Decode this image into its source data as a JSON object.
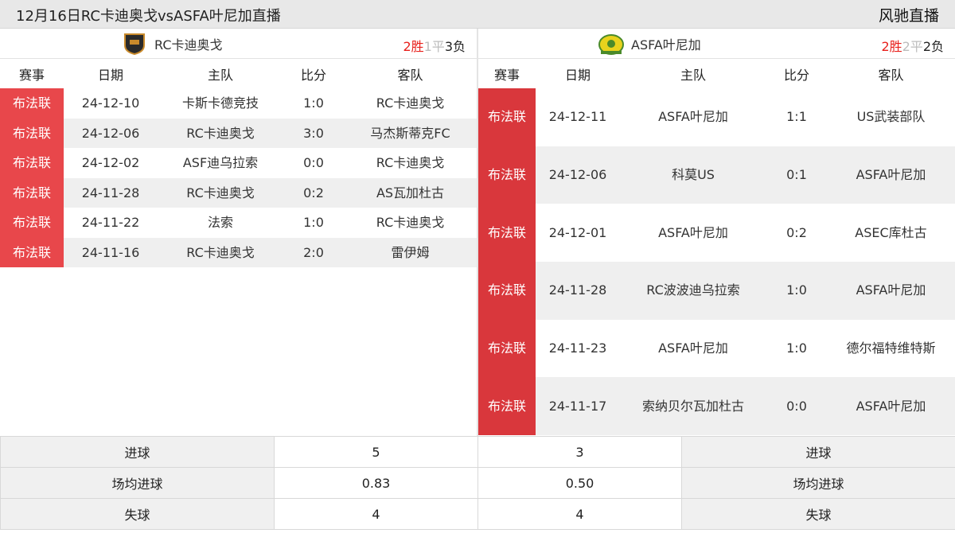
{
  "header": {
    "title": "12月16日RC卡迪奥戈vsASFA叶尼加直播",
    "brand": "风驰直播"
  },
  "columns": {
    "league": "赛事",
    "date": "日期",
    "home": "主队",
    "score": "比分",
    "away": "客队"
  },
  "left_team": {
    "name": "RC卡迪奥戈",
    "logo_icon": "team-crest-icon",
    "record": {
      "wins": "2胜",
      "draws": "1平",
      "losses": "3负"
    },
    "games": [
      {
        "league": "布法联",
        "date": "24-12-10",
        "home": "卡斯卡德竞技",
        "score": "1:0",
        "away": "RC卡迪奥戈"
      },
      {
        "league": "布法联",
        "date": "24-12-06",
        "home": "RC卡迪奥戈",
        "score": "3:0",
        "away": "马杰斯蒂克FC"
      },
      {
        "league": "布法联",
        "date": "24-12-02",
        "home": "ASF迪乌拉索",
        "score": "0:0",
        "away": "RC卡迪奥戈"
      },
      {
        "league": "布法联",
        "date": "24-11-28",
        "home": "RC卡迪奥戈",
        "score": "0:2",
        "away": "AS瓦加杜古"
      },
      {
        "league": "布法联",
        "date": "24-11-22",
        "home": "法索",
        "score": "1:0",
        "away": "RC卡迪奥戈"
      },
      {
        "league": "布法联",
        "date": "24-11-16",
        "home": "RC卡迪奥戈",
        "score": "2:0",
        "away": "雷伊姆"
      }
    ]
  },
  "right_team": {
    "name": "ASFA叶尼加",
    "logo_icon": "team-crest-icon",
    "record": {
      "wins": "2胜",
      "draws": "2平",
      "losses": "2负"
    },
    "games": [
      {
        "league": "布法联",
        "date": "24-12-11",
        "home": "ASFA叶尼加",
        "score": "1:1",
        "away": "US武装部队"
      },
      {
        "league": "布法联",
        "date": "24-12-06",
        "home": "科莫US",
        "score": "0:1",
        "away": "ASFA叶尼加"
      },
      {
        "league": "布法联",
        "date": "24-12-01",
        "home": "ASFA叶尼加",
        "score": "0:2",
        "away": "ASEC库杜古"
      },
      {
        "league": "布法联",
        "date": "24-11-28",
        "home": "RC波波迪乌拉索",
        "score": "1:0",
        "away": "ASFA叶尼加"
      },
      {
        "league": "布法联",
        "date": "24-11-23",
        "home": "ASFA叶尼加",
        "score": "1:0",
        "away": "德尔福特维特斯"
      },
      {
        "league": "布法联",
        "date": "24-11-17",
        "home": "索纳贝尔瓦加杜古",
        "score": "0:0",
        "away": "ASFA叶尼加"
      }
    ]
  },
  "stats": [
    {
      "label": "进球",
      "left": "5",
      "right": "3"
    },
    {
      "label": "场均进球",
      "left": "0.83",
      "right": "0.50"
    },
    {
      "label": "失球",
      "left": "4",
      "right": "4"
    }
  ],
  "colors": {
    "league_badge": "#e8474b",
    "win": "#e8201c",
    "draw": "#bdbdbd"
  }
}
